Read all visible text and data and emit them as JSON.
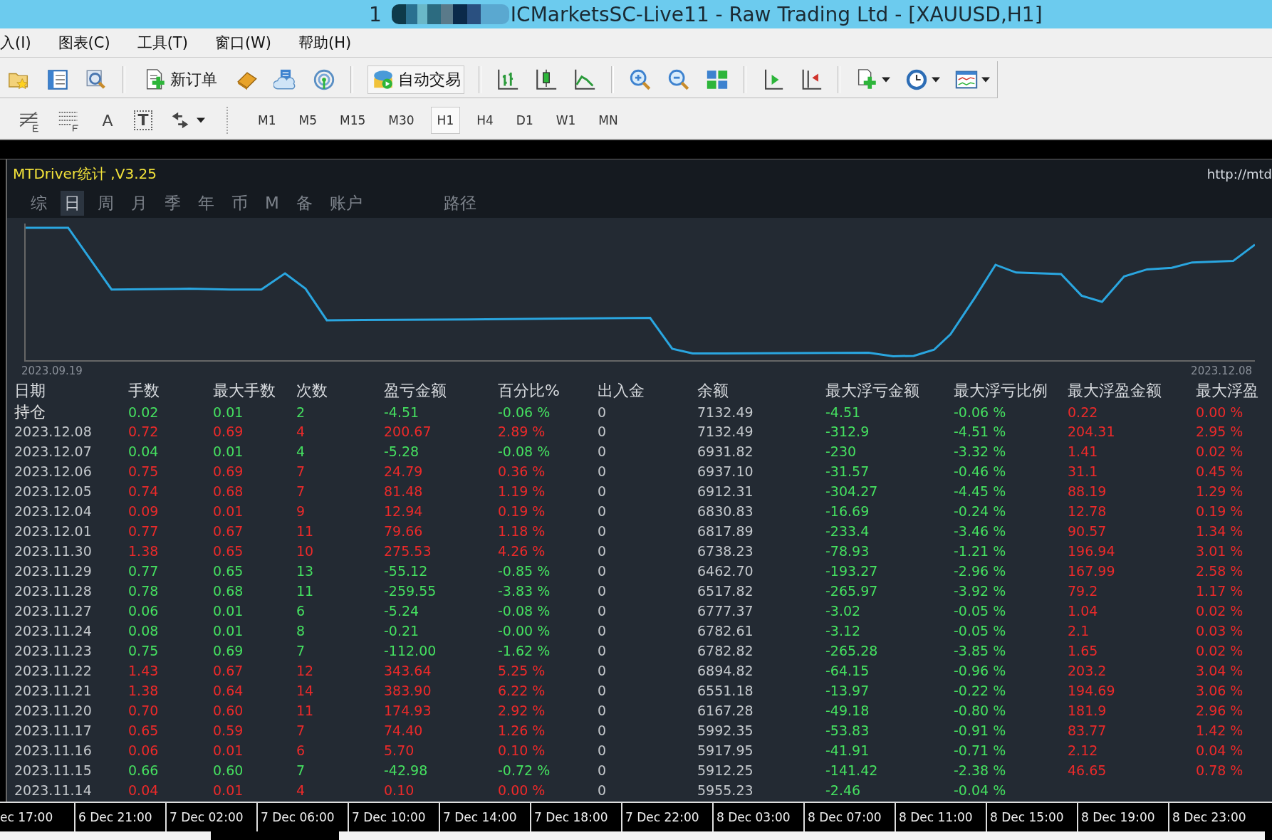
{
  "window": {
    "title_number": "1",
    "title": "ICMarketsSC-Live11 - Raw Trading Ltd - [XAUUSD,H1]"
  },
  "menu": [
    "入(I)",
    "图表(C)",
    "工具(T)",
    "窗口(W)",
    "帮助(H)"
  ],
  "toolbar": {
    "new_order": "新订单",
    "auto_trading": "自动交易"
  },
  "draw_tools": [
    {
      "label": "A",
      "kind": "text"
    },
    {
      "label": "T",
      "kind": "boxed"
    }
  ],
  "timeframes": [
    {
      "label": "M1",
      "selected": false
    },
    {
      "label": "M5",
      "selected": false
    },
    {
      "label": "M15",
      "selected": false
    },
    {
      "label": "M30",
      "selected": false
    },
    {
      "label": "H1",
      "selected": true
    },
    {
      "label": "H4",
      "selected": false
    },
    {
      "label": "D1",
      "selected": false
    },
    {
      "label": "W1",
      "selected": false
    },
    {
      "label": "MN",
      "selected": false
    }
  ],
  "panel": {
    "title": "MTDriver统计 ,V3.25",
    "link": "http://mtd",
    "tabs": [
      {
        "label": "综",
        "selected": false
      },
      {
        "label": "日",
        "selected": true
      },
      {
        "label": "周",
        "selected": false
      },
      {
        "label": "月",
        "selected": false
      },
      {
        "label": "季",
        "selected": false
      },
      {
        "label": "年",
        "selected": false
      },
      {
        "label": "币",
        "selected": false
      },
      {
        "label": "M",
        "selected": false
      },
      {
        "label": "备",
        "selected": false
      },
      {
        "label": "账户",
        "selected": false
      }
    ],
    "path_tab": "路径",
    "chart": {
      "start_label": "2023.09.19",
      "end_label": "2023.12.08"
    },
    "table": {
      "columns": [
        "日期",
        "手数",
        "最大手数",
        "次数",
        "盈亏金额",
        "百分比%",
        "出入金",
        "余额",
        "最大浮亏金额",
        "最大浮亏比例",
        "最大浮盈金额",
        "最大浮盈"
      ],
      "rows": [
        {
          "kind": "loss",
          "cells": [
            "持仓",
            "0.02",
            "0.01",
            "2",
            "-4.51",
            "-0.06 %",
            "0",
            "7132.49",
            "-4.51",
            "-0.06 %",
            "0.22",
            "0.00 %"
          ]
        },
        {
          "kind": "profit",
          "cells": [
            "2023.12.08",
            "0.72",
            "0.69",
            "4",
            "200.67",
            "2.89 %",
            "0",
            "7132.49",
            "-312.9",
            "-4.51 %",
            "204.31",
            "2.95 %"
          ]
        },
        {
          "kind": "loss",
          "cells": [
            "2023.12.07",
            "0.04",
            "0.01",
            "4",
            "-5.28",
            "-0.08 %",
            "0",
            "6931.82",
            "-230",
            "-3.32 %",
            "1.41",
            "0.02 %"
          ]
        },
        {
          "kind": "profit",
          "cells": [
            "2023.12.06",
            "0.75",
            "0.69",
            "7",
            "24.79",
            "0.36 %",
            "0",
            "6937.10",
            "-31.57",
            "-0.46 %",
            "31.1",
            "0.45 %"
          ]
        },
        {
          "kind": "profit",
          "cells": [
            "2023.12.05",
            "0.74",
            "0.68",
            "7",
            "81.48",
            "1.19 %",
            "0",
            "6912.31",
            "-304.27",
            "-4.45 %",
            "88.19",
            "1.29 %"
          ]
        },
        {
          "kind": "profit",
          "cells": [
            "2023.12.04",
            "0.09",
            "0.01",
            "9",
            "12.94",
            "0.19 %",
            "0",
            "6830.83",
            "-16.69",
            "-0.24 %",
            "12.78",
            "0.19 %"
          ]
        },
        {
          "kind": "profit",
          "cells": [
            "2023.12.01",
            "0.77",
            "0.67",
            "11",
            "79.66",
            "1.18 %",
            "0",
            "6817.89",
            "-233.4",
            "-3.46 %",
            "90.57",
            "1.34 %"
          ]
        },
        {
          "kind": "profit",
          "cells": [
            "2023.11.30",
            "1.38",
            "0.65",
            "10",
            "275.53",
            "4.26 %",
            "0",
            "6738.23",
            "-78.93",
            "-1.21 %",
            "196.94",
            "3.01 %"
          ]
        },
        {
          "kind": "loss",
          "cells": [
            "2023.11.29",
            "0.77",
            "0.65",
            "13",
            "-55.12",
            "-0.85 %",
            "0",
            "6462.70",
            "-193.27",
            "-2.96 %",
            "167.99",
            "2.58 %"
          ]
        },
        {
          "kind": "loss",
          "cells": [
            "2023.11.28",
            "0.78",
            "0.68",
            "11",
            "-259.55",
            "-3.83 %",
            "0",
            "6517.82",
            "-265.97",
            "-3.92 %",
            "79.2",
            "1.17 %"
          ]
        },
        {
          "kind": "loss",
          "cells": [
            "2023.11.27",
            "0.06",
            "0.01",
            "6",
            "-5.24",
            "-0.08 %",
            "0",
            "6777.37",
            "-3.02",
            "-0.05 %",
            "1.04",
            "0.02 %"
          ]
        },
        {
          "kind": "loss",
          "cells": [
            "2023.11.24",
            "0.08",
            "0.01",
            "8",
            "-0.21",
            "-0.00 %",
            "0",
            "6782.61",
            "-3.12",
            "-0.05 %",
            "2.1",
            "0.03 %"
          ]
        },
        {
          "kind": "loss",
          "cells": [
            "2023.11.23",
            "0.75",
            "0.69",
            "7",
            "-112.00",
            "-1.62 %",
            "0",
            "6782.82",
            "-265.28",
            "-3.85 %",
            "1.65",
            "0.02 %"
          ]
        },
        {
          "kind": "profit",
          "cells": [
            "2023.11.22",
            "1.43",
            "0.67",
            "12",
            "343.64",
            "5.25 %",
            "0",
            "6894.82",
            "-64.15",
            "-0.96 %",
            "203.2",
            "3.04 %"
          ]
        },
        {
          "kind": "profit",
          "cells": [
            "2023.11.21",
            "1.38",
            "0.64",
            "14",
            "383.90",
            "6.22 %",
            "0",
            "6551.18",
            "-13.97",
            "-0.22 %",
            "194.69",
            "3.06 %"
          ]
        },
        {
          "kind": "profit",
          "cells": [
            "2023.11.20",
            "0.70",
            "0.60",
            "11",
            "174.93",
            "2.92 %",
            "0",
            "6167.28",
            "-49.18",
            "-0.80 %",
            "181.9",
            "2.96 %"
          ]
        },
        {
          "kind": "profit",
          "cells": [
            "2023.11.17",
            "0.65",
            "0.59",
            "7",
            "74.40",
            "1.26 %",
            "0",
            "5992.35",
            "-53.83",
            "-0.91 %",
            "83.77",
            "1.42 %"
          ]
        },
        {
          "kind": "profit",
          "cells": [
            "2023.11.16",
            "0.06",
            "0.01",
            "6",
            "5.70",
            "0.10 %",
            "0",
            "5917.95",
            "-41.91",
            "-0.71 %",
            "2.12",
            "0.04 %"
          ]
        },
        {
          "kind": "loss",
          "cells": [
            "2023.11.15",
            "0.66",
            "0.60",
            "7",
            "-42.98",
            "-0.72 %",
            "0",
            "5912.25",
            "-141.42",
            "-2.38 %",
            "46.65",
            "0.78 %"
          ]
        },
        {
          "kind": "profit",
          "cells": [
            "2023.11.14",
            "0.04",
            "0.01",
            "4",
            "0.10",
            "0.00 %",
            "0",
            "5955.23",
            "-2.46",
            "-0.04 %"
          ]
        }
      ]
    }
  },
  "time_axis": [
    "ec 17:00",
    "6 Dec 21:00",
    "7 Dec 02:00",
    "7 Dec 06:00",
    "7 Dec 10:00",
    "7 Dec 14:00",
    "7 Dec 18:00",
    "7 Dec 22:00",
    "8 Dec 03:00",
    "8 Dec 07:00",
    "8 Dec 11:00",
    "8 Dec 15:00",
    "8 Dec 19:00",
    "8 Dec 23:00"
  ]
}
